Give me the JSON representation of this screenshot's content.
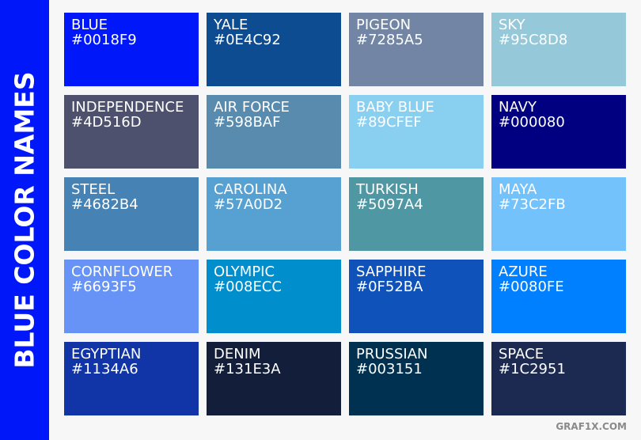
{
  "title": "BLUE COLOR NAMES",
  "credit": "GRAF1X.COM",
  "sidebar_color": "#0018F9",
  "swatches": [
    {
      "name": "BLUE",
      "hex": "#0018F9",
      "color": "#0018F9"
    },
    {
      "name": "YALE",
      "hex": "#0E4C92",
      "color": "#0E4C92"
    },
    {
      "name": "PIGEON",
      "hex": "#7285A5",
      "color": "#7285A5"
    },
    {
      "name": "SKY",
      "hex": "#95C8D8",
      "color": "#95C8D8"
    },
    {
      "name": "INDEPENDENCE",
      "hex": "#4D516D",
      "color": "#4D516D"
    },
    {
      "name": "AIR FORCE",
      "hex": "#598BAF",
      "color": "#598BAF"
    },
    {
      "name": "BABY BLUE",
      "hex": "#89CFEF",
      "color": "#89CFEF"
    },
    {
      "name": "NAVY",
      "hex": "#000080",
      "color": "#000080"
    },
    {
      "name": "STEEL",
      "hex": "#4682B4",
      "color": "#4682B4"
    },
    {
      "name": "CAROLINA",
      "hex": "#57A0D2",
      "color": "#57A0D2"
    },
    {
      "name": "TURKISH",
      "hex": "#5097A4",
      "color": "#5097A4"
    },
    {
      "name": "MAYA",
      "hex": "#73C2FB",
      "color": "#73C2FB"
    },
    {
      "name": "CORNFLOWER",
      "hex": "#6693F5",
      "color": "#6693F5"
    },
    {
      "name": "OLYMPIC",
      "hex": "#008ECC",
      "color": "#008ECC"
    },
    {
      "name": "SAPPHIRE",
      "hex": "#0F52BA",
      "color": "#0F52BA"
    },
    {
      "name": "AZURE",
      "hex": "#0080FE",
      "color": "#0080FE"
    },
    {
      "name": "EGYPTIAN",
      "hex": "#1134A6",
      "color": "#1134A6"
    },
    {
      "name": "DENIM",
      "hex": "#131E3A",
      "color": "#131E3A"
    },
    {
      "name": "PRUSSIAN",
      "hex": "#003151",
      "color": "#003151"
    },
    {
      "name": "SPACE",
      "hex": "#1C2951",
      "color": "#1C2951"
    }
  ]
}
